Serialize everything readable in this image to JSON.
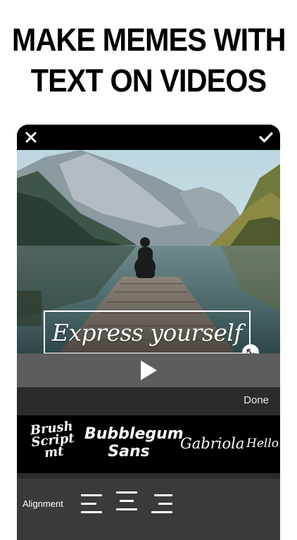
{
  "headline": {
    "line1": "MAKE MEMES WITH",
    "line2": "TEXT ON VIDEOS"
  },
  "editor": {
    "caption_text": "Express yourself",
    "done_label": "Done",
    "alignment_label": "Alignment",
    "fonts": [
      {
        "line1": "Brush",
        "line2": "Script",
        "line3": "mt"
      },
      {
        "line1": "Bubblegum",
        "line2": "Sans"
      },
      {
        "line1": "Gabriola"
      },
      {
        "line1": "Hello B"
      }
    ]
  },
  "icons": {
    "close": "close-icon",
    "confirm": "checkmark-icon",
    "play": "play-icon",
    "resize": "resize-icon",
    "align_left": "align-left-icon",
    "align_center": "align-center-icon",
    "align_right": "align-right-icon"
  },
  "colors": {
    "device_bg": "#1c1c1e",
    "player_bar": "#5d5d60",
    "font_bar": "#000000",
    "alignment_bar": "#3a3a3c"
  }
}
